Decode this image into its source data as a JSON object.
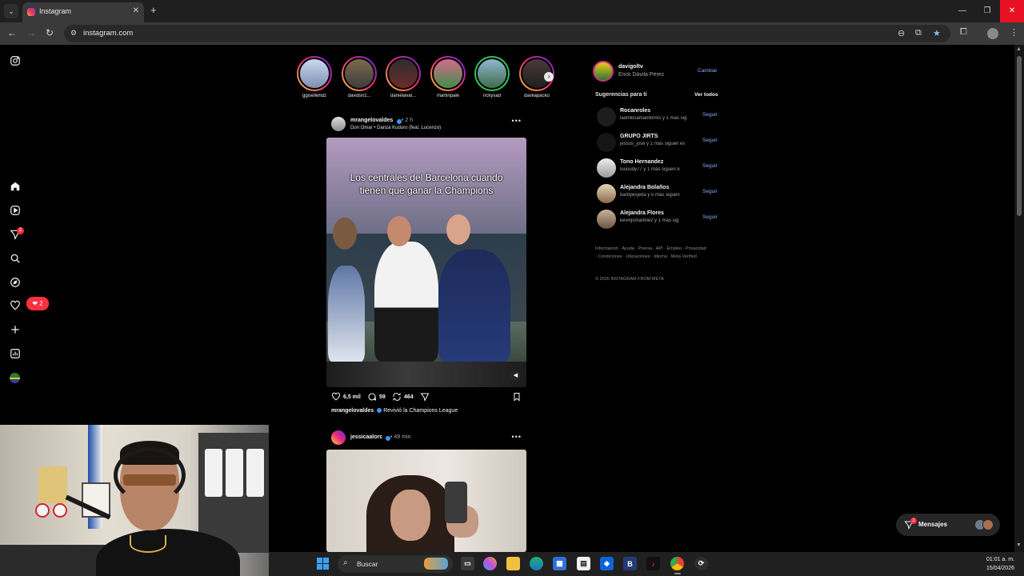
{
  "browser": {
    "tab_title": "Instagram",
    "url": "instagram.com"
  },
  "left_nav": {
    "items": [
      "instagram-logo",
      "home",
      "reels",
      "direct",
      "search",
      "explore",
      "notifications",
      "create",
      "dashboard",
      "profile"
    ],
    "direct_badge": "2",
    "notifications_count": "2"
  },
  "stories": [
    {
      "name": "ggisellehdz"
    },
    {
      "name": "davidsriz..."
    },
    {
      "name": "danielaval..."
    },
    {
      "name": "martinpale"
    },
    {
      "name": "rickysad"
    },
    {
      "name": "davilapacko"
    }
  ],
  "posts": [
    {
      "username": "mrangelovaldes",
      "time": "• 2 h",
      "audio": "Don Omar • Danza Kuduro (feat. Lucenzo)",
      "caption_overlay": "Los centrales del Barcelona cuando tienen que ganar la Champions",
      "likes": "6,5 mil",
      "comments": "59",
      "reposts": "464",
      "liked_by_user": "mrangelovaldes",
      "liked_text": "Revivió la Champions League"
    },
    {
      "username": "jessicaalorc",
      "time": "• 49 min"
    }
  ],
  "sidebar": {
    "account": {
      "username": "davigoltv",
      "full_name": "Erick Dávila Pérez",
      "switch_label": "Cambiar"
    },
    "suggestions_title": "Sugerencias para ti",
    "see_all_label": "Ver todos",
    "suggestions": [
      {
        "name": "Rocanroles",
        "sub": "ladrillosamarillorms y 1 más sig",
        "action": "Seguir"
      },
      {
        "name": "GRUPO JIRTS",
        "sub": "jessus_jose y 1 más siguen es",
        "action": "Seguir"
      },
      {
        "name": "Tono Hernandez",
        "sub": "luuuudy77 y 1 más siguen e",
        "action": "Seguir"
      },
      {
        "name": "Alejandra Bolaños",
        "sub": "barbyecjeda y 5 más siguen",
        "action": "Seguir"
      },
      {
        "name": "Alejandra Flores",
        "sub": "kevinjcmartinez y 1 más sig",
        "action": "Seguir"
      }
    ],
    "footer_links": "Información · Ayuda · Prensa · API · Empleo · Privacidad · Condiciones · Ubicaciones · Idioma · Meta Verified",
    "copyright": "© 2026 INSTAGRAM FROM META"
  },
  "messages": {
    "label": "Mensajes",
    "badge": "2"
  },
  "taskbar": {
    "search_label": "Buscar",
    "time": "01:01 a. m.",
    "date": "15/04/2026"
  },
  "colors": {
    "background": "#000000",
    "link_blue": "#8aa9ff",
    "notification_red": "#ff3040",
    "verified_blue": "#3897f0"
  }
}
